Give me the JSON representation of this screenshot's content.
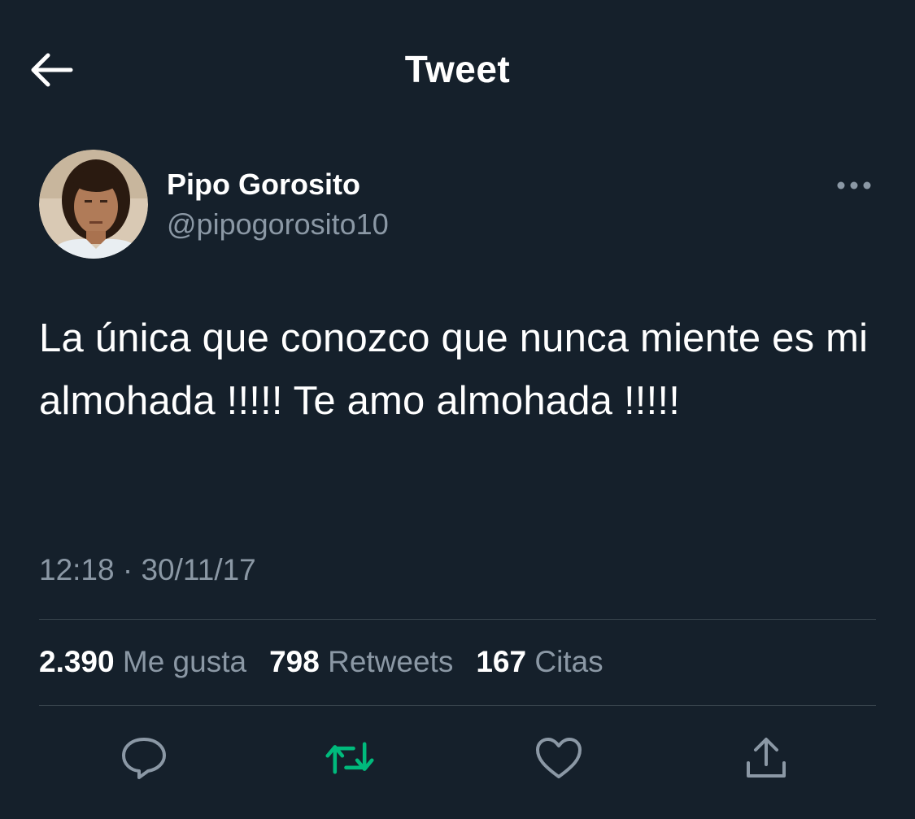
{
  "header": {
    "title": "Tweet",
    "back_icon": "arrow-left-icon"
  },
  "author": {
    "display_name": "Pipo Gorosito",
    "handle": "@pipogorosito10"
  },
  "tweet": {
    "text": "La única que conozco que nunca miente es mi almohada !!!!! Te amo almohada !!!!!",
    "timestamp": "12:18 · 30/11/17"
  },
  "stats": {
    "likes_count": "2.390",
    "likes_label": "Me gusta",
    "retweets_count": "798",
    "retweets_label": "Retweets",
    "quotes_count": "167",
    "quotes_label": "Citas"
  },
  "actions": {
    "icons": [
      "reply-icon",
      "retweet-icon",
      "like-icon",
      "share-icon"
    ]
  },
  "colors": {
    "background": "#15202b",
    "text_primary": "#ffffff",
    "text_secondary": "#8b98a5",
    "divider": "#38444d",
    "retweet_active": "#00ba7c"
  }
}
